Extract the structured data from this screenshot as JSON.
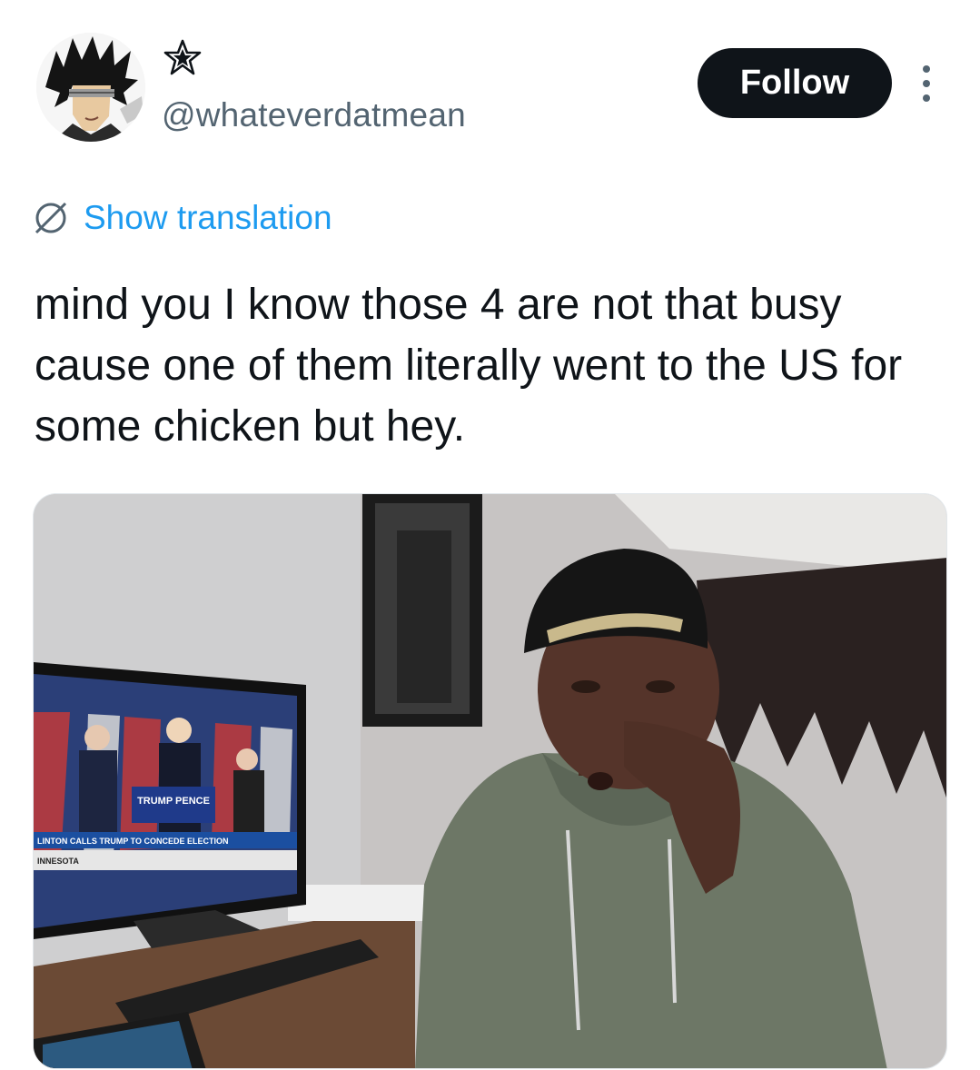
{
  "user": {
    "handle": "@whateverdatmean",
    "avatar_icon": "anime-character-avatar",
    "badge_icon": "star-icon"
  },
  "actions": {
    "follow_label": "Follow",
    "more_icon": "more-vertical-icon"
  },
  "translation": {
    "label": "Show translation",
    "icon": "globe-icon",
    "link_color": "#1d9bf0"
  },
  "tweet": {
    "text": "mind you I know those 4 are not that busy cause one of them literally went to the US for some chicken but hey."
  },
  "media": {
    "tv_caption": "TRUMP PENCE",
    "tv_ticker": "LINTON CALLS TRUMP TO CONCEDE ELECTION",
    "tv_state": "INNESOTA"
  },
  "colors": {
    "text": "#0f1419",
    "secondary": "#536471",
    "button_bg": "#0f1419",
    "button_text": "#ffffff"
  }
}
